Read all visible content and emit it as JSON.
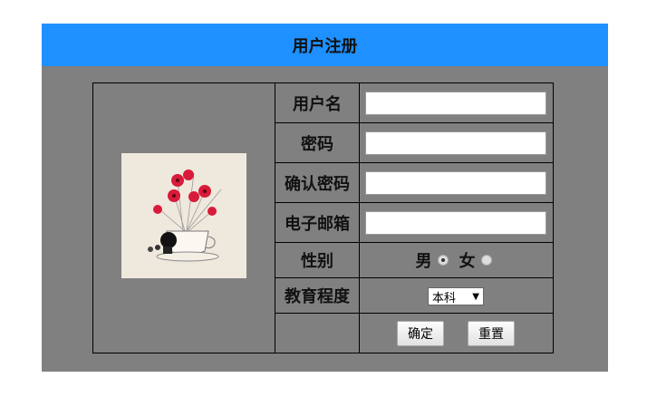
{
  "header": {
    "title": "用户注册"
  },
  "form": {
    "username_label": "用户名",
    "password_label": "密码",
    "confirm_label": "确认密码",
    "email_label": "电子邮箱",
    "gender_label": "性别",
    "gender_options": [
      "男",
      "女"
    ],
    "gender_selected": "男",
    "education_label": "教育程度",
    "education_value": "本科",
    "submit_label": "确定",
    "reset_label": "重置"
  },
  "colors": {
    "header": "#1e90ff",
    "panel": "#808080",
    "accent_flowers": "#d81b3a"
  },
  "icons": {
    "select_arrow": "▼"
  }
}
